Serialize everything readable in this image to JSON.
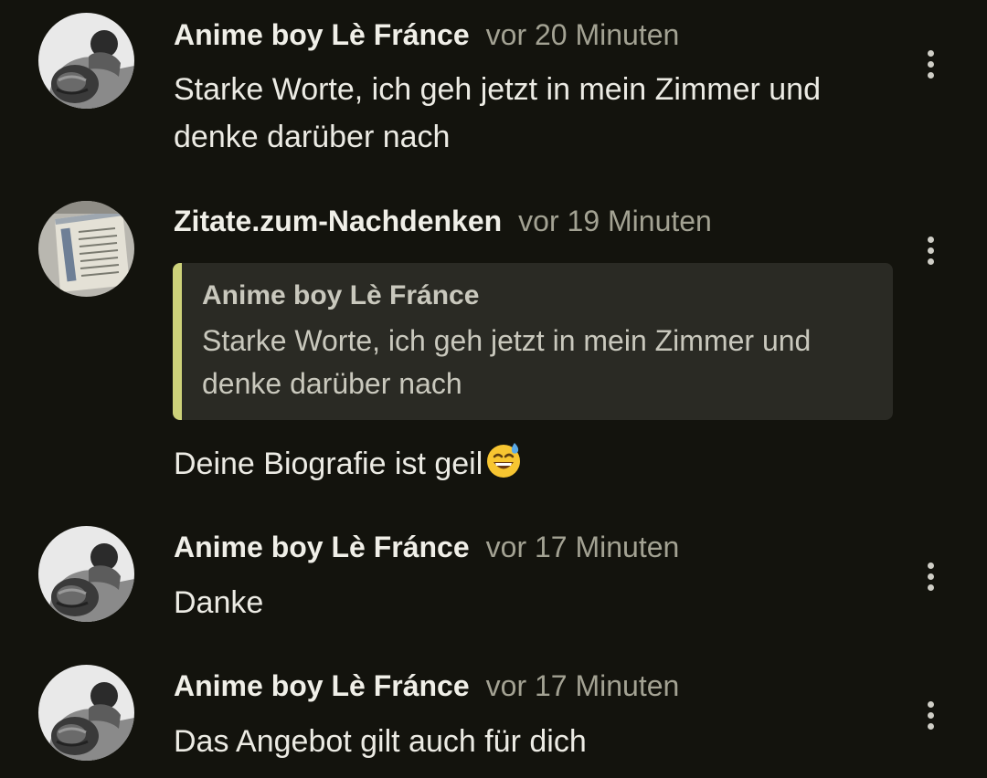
{
  "comments": [
    {
      "author": "Anime boy Lè Fránce",
      "time": "vor 20 Minuten",
      "text": "Starke Worte, ich geh jetzt in mein Zimmer und denke darüber nach",
      "avatar": "boxer-photo"
    },
    {
      "author": "Zitate.zum-Nachdenken",
      "time": "vor 19 Minuten",
      "avatar": "document-photo",
      "quote": {
        "author": "Anime boy Lè Fránce",
        "text": "Starke Worte, ich geh jetzt in mein Zimmer und denke darüber nach"
      },
      "text": "Deine Biografie ist geil",
      "emoji": "grinning-face-with-sweat-emoji"
    },
    {
      "author": "Anime boy Lè Fránce",
      "time": "vor 17 Minuten",
      "text": "Danke",
      "avatar": "boxer-photo"
    },
    {
      "author": "Anime boy Lè Fránce",
      "time": "vor 17 Minuten",
      "text": "Das Angebot gilt auch für dich",
      "avatar": "boxer-photo"
    }
  ],
  "icons": {
    "menu": "more-vertical-icon"
  },
  "colors": {
    "background": "#13130d",
    "quote_accent": "#cdd27a",
    "quote_background": "#2a2a24"
  }
}
